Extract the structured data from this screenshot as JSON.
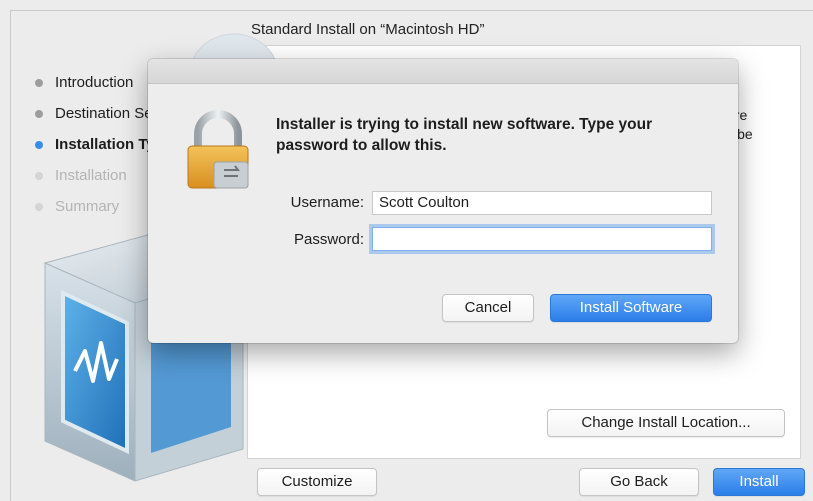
{
  "installer": {
    "title": "Standard Install on “Macintosh HD”",
    "background_text_line1": "are",
    "background_text_line2": "ll be",
    "steps": [
      {
        "label": "Introduction",
        "state": "done"
      },
      {
        "label": "Destination Select",
        "state": "done"
      },
      {
        "label": "Installation Type",
        "state": "active"
      },
      {
        "label": "Installation",
        "state": "dim"
      },
      {
        "label": "Summary",
        "state": "dim"
      }
    ],
    "change_location_label": "Change Install Location...",
    "customize_label": "Customize",
    "go_back_label": "Go Back",
    "install_label": "Install"
  },
  "auth_dialog": {
    "message": "Installer is trying to install new software. Type your password to allow this.",
    "username_label": "Username:",
    "username_value": "Scott Coulton",
    "password_label": "Password:",
    "password_value": "",
    "cancel_label": "Cancel",
    "confirm_label": "Install Software"
  },
  "icons": {
    "lock": "lock-icon",
    "virtualbox": "virtualbox-logo-icon"
  },
  "colors": {
    "accent": "#2b7de9",
    "active_step_dot": "#3a8de6"
  }
}
